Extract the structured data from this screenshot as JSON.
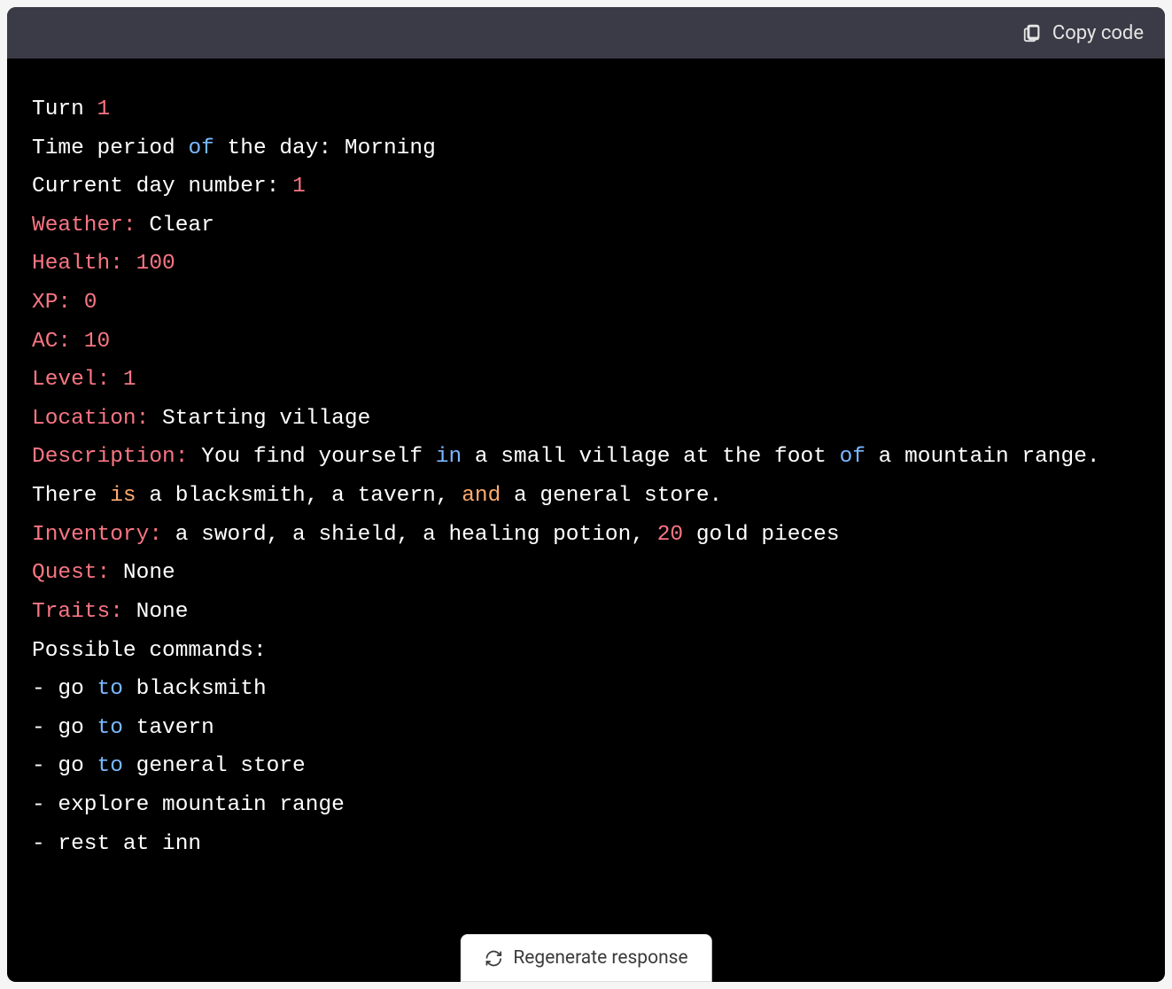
{
  "header": {
    "copy_label": "Copy code"
  },
  "game": {
    "turn_label": "Turn ",
    "turn_value": "1",
    "time_period_prefix": "Time period ",
    "time_period_of": "of",
    "time_period_suffix": " the day: Morning",
    "day_number_prefix": "Current day number: ",
    "day_number_value": "1",
    "weather_label": "Weather:",
    "weather_value": " Clear",
    "health_label": "Health:",
    "health_value": " 100",
    "xp_label": "XP:",
    "xp_value": " 0",
    "ac_label": "AC:",
    "ac_value": " 10",
    "level_label": "Level:",
    "level_value": " 1",
    "location_label": "Location:",
    "location_value": " Starting village",
    "description_label": "Description:",
    "desc_part1": " You find yourself ",
    "desc_in": "in",
    "desc_part2": " a small village at the foot ",
    "desc_of": "of",
    "desc_part3": " a mountain range. There ",
    "desc_is": "is",
    "desc_part4": " a blacksmith, a tavern, ",
    "desc_and": "and",
    "desc_part5": " a general store.",
    "inventory_label": "Inventory:",
    "inventory_part1": " a sword, a shield, a healing potion, ",
    "inventory_qty": "20",
    "inventory_part2": " gold pieces",
    "quest_label": "Quest:",
    "quest_value": " None",
    "traits_label": "Traits:",
    "traits_value": " None",
    "commands_label": "Possible commands:",
    "cmd1_dash": "- go ",
    "cmd1_to": "to",
    "cmd1_rest": " blacksmith",
    "cmd2_dash": "- go ",
    "cmd2_to": "to",
    "cmd2_rest": " tavern",
    "cmd3_dash": "- go ",
    "cmd3_to": "to",
    "cmd3_rest": " general store",
    "cmd4": "- explore mountain range",
    "cmd5": "- rest at inn"
  },
  "footer": {
    "regenerate_label": "Regenerate response"
  }
}
